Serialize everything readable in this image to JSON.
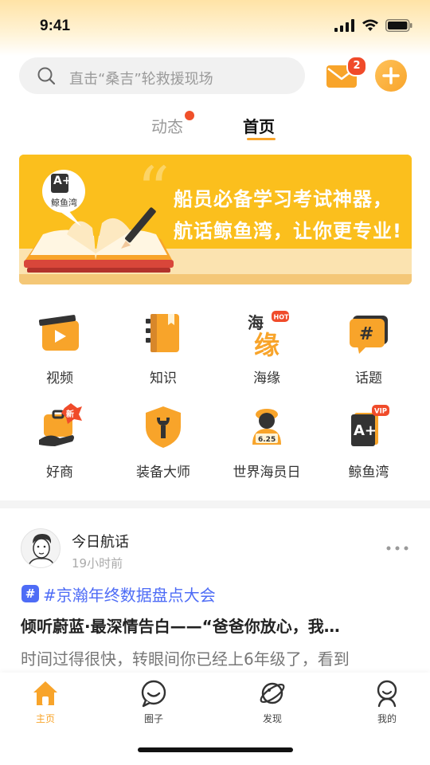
{
  "status_bar": {
    "time": "9:41"
  },
  "search": {
    "placeholder": "直击“桑吉”轮救援现场"
  },
  "header": {
    "mail_badge_count": "2"
  },
  "tabs": [
    {
      "label": "动态",
      "active": false,
      "has_dot": true
    },
    {
      "label": "首页",
      "active": true
    }
  ],
  "banner": {
    "line1": "船员必备学习考试神器，",
    "line2": "航话鲸鱼湾，让你更专业!",
    "logo_text": "鲸鱼湾",
    "grade": "A+"
  },
  "grid": [
    {
      "label": "视频",
      "icon": "video-icon"
    },
    {
      "label": "知识",
      "icon": "book-icon"
    },
    {
      "label": "海缘",
      "icon": "haiyuan-icon",
      "badge": "HOT",
      "glyph_top": "海",
      "glyph_bottom": "缘"
    },
    {
      "label": "话题",
      "icon": "topic-icon"
    },
    {
      "label": "好商",
      "icon": "shop-icon",
      "badge": "新"
    },
    {
      "label": "装备大师",
      "icon": "wrench-shield-icon"
    },
    {
      "label": "世界海员日",
      "icon": "sailor-icon",
      "date": "6.25"
    },
    {
      "label": "鲸鱼湾",
      "icon": "jingyuwan-icon",
      "badge": "VIP",
      "grade": "A+"
    }
  ],
  "post": {
    "author": "今日航话",
    "time": "19小时前",
    "topic": "#京瀚年终数据盘点大会",
    "title": "倾听蔚蓝·最深情告白——“爸爸你放心，我…",
    "excerpt": "时间过得很快，转眼间你已经上6年级了，看到"
  },
  "bottom_nav": [
    {
      "label": "主页",
      "active": true
    },
    {
      "label": "圈子",
      "active": false
    },
    {
      "label": "发现",
      "active": false
    },
    {
      "label": "我的",
      "active": false
    }
  ],
  "colors": {
    "accent": "#f8a42a",
    "topic": "#4e6cf6",
    "badge": "#f04b2a"
  }
}
